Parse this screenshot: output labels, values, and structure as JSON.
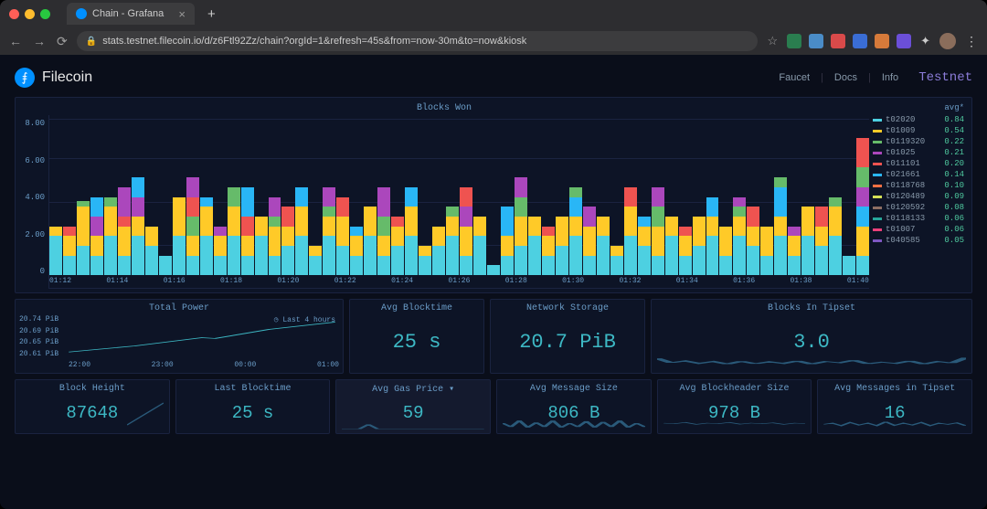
{
  "browser": {
    "tab_title": "Chain - Grafana",
    "url": "stats.testnet.filecoin.io/d/z6Ftl92Zz/chain?orgId=1&refresh=45s&from=now-30m&to=now&kiosk",
    "traffic_lights": [
      "#ff5f57",
      "#ffbd2e",
      "#28c840"
    ],
    "ext_colors": [
      "#2a7d4f",
      "#4a8cc7",
      "#d94a4a",
      "#3a6dd4",
      "#d67a3a",
      "#6b4fd8"
    ]
  },
  "header": {
    "brand": "Filecoin",
    "nav": [
      "Faucet",
      "Docs",
      "Info"
    ],
    "testnet": "Testnet"
  },
  "chart_data": {
    "type": "bar",
    "title": "Blocks Won",
    "ylabel": "",
    "ylim": [
      0,
      8
    ],
    "y_ticks": [
      "8.00",
      "6.00",
      "4.00",
      "2.00",
      "0"
    ],
    "x_ticks": [
      "01:12",
      "01:14",
      "01:16",
      "01:18",
      "01:20",
      "01:22",
      "01:24",
      "01:26",
      "01:28",
      "01:30",
      "01:32",
      "01:34",
      "01:36",
      "01:38",
      "01:40"
    ],
    "series_colors": {
      "t02020": "#4dd0e1",
      "t01009": "#ffca28",
      "t0119320": "#66bb6a",
      "t01025": "#ab47bc",
      "t011101": "#ef5350",
      "t021661": "#29b6f6",
      "t0118768": "#ff7043",
      "t0120489": "#d4e157",
      "t0120592": "#8d6e63",
      "t0118133": "#26a69a",
      "t01007": "#ec407a",
      "t040585": "#7e57c2"
    },
    "stacked_bars": [
      [
        [
          "t02020",
          2
        ],
        [
          "t01009",
          0.5
        ]
      ],
      [
        [
          "t02020",
          1
        ],
        [
          "t01009",
          1
        ],
        [
          "t011101",
          0.5
        ]
      ],
      [
        [
          "t02020",
          1.5
        ],
        [
          "t01009",
          2
        ],
        [
          "t0119320",
          0.3
        ]
      ],
      [
        [
          "t02020",
          1
        ],
        [
          "t01009",
          1
        ],
        [
          "t01025",
          1
        ],
        [
          "t021661",
          1
        ]
      ],
      [
        [
          "t02020",
          2
        ],
        [
          "t01009",
          1.5
        ],
        [
          "t0119320",
          0.5
        ]
      ],
      [
        [
          "t02020",
          1
        ],
        [
          "t01009",
          1.5
        ],
        [
          "t011101",
          0.5
        ],
        [
          "t01025",
          1.5
        ]
      ],
      [
        [
          "t02020",
          2
        ],
        [
          "t01009",
          1
        ],
        [
          "t01025",
          1
        ],
        [
          "t021661",
          1
        ]
      ],
      [
        [
          "t02020",
          1.5
        ],
        [
          "t01009",
          1
        ]
      ],
      [
        [
          "t02020",
          1
        ]
      ],
      [
        [
          "t02020",
          2
        ],
        [
          "t01009",
          2
        ]
      ],
      [
        [
          "t02020",
          1
        ],
        [
          "t01009",
          1
        ],
        [
          "t0119320",
          1
        ],
        [
          "t011101",
          1
        ],
        [
          "t01025",
          1
        ]
      ],
      [
        [
          "t02020",
          2
        ],
        [
          "t01009",
          1.5
        ],
        [
          "t021661",
          0.5
        ]
      ],
      [
        [
          "t02020",
          1
        ],
        [
          "t01009",
          1
        ],
        [
          "t01025",
          0.5
        ]
      ],
      [
        [
          "t02020",
          2
        ],
        [
          "t01009",
          1.5
        ],
        [
          "t0119320",
          1
        ]
      ],
      [
        [
          "t02020",
          1
        ],
        [
          "t01009",
          1
        ],
        [
          "t011101",
          1
        ],
        [
          "t021661",
          1.5
        ]
      ],
      [
        [
          "t02020",
          2
        ],
        [
          "t01009",
          1
        ]
      ],
      [
        [
          "t02020",
          1
        ],
        [
          "t01009",
          1.5
        ],
        [
          "t0119320",
          0.5
        ],
        [
          "t01025",
          1
        ]
      ],
      [
        [
          "t02020",
          1.5
        ],
        [
          "t01009",
          1
        ],
        [
          "t011101",
          1
        ]
      ],
      [
        [
          "t02020",
          2
        ],
        [
          "t01009",
          1.5
        ],
        [
          "t021661",
          1
        ]
      ],
      [
        [
          "t02020",
          1
        ],
        [
          "t01009",
          0.5
        ]
      ],
      [
        [
          "t02020",
          2
        ],
        [
          "t01009",
          1
        ],
        [
          "t0119320",
          0.5
        ],
        [
          "t01025",
          1
        ]
      ],
      [
        [
          "t02020",
          1.5
        ],
        [
          "t01009",
          1.5
        ],
        [
          "t011101",
          1
        ]
      ],
      [
        [
          "t02020",
          1
        ],
        [
          "t01009",
          1
        ],
        [
          "t021661",
          0.5
        ]
      ],
      [
        [
          "t02020",
          2
        ],
        [
          "t01009",
          1.5
        ]
      ],
      [
        [
          "t02020",
          1
        ],
        [
          "t01009",
          1
        ],
        [
          "t0119320",
          1
        ],
        [
          "t01025",
          1.5
        ]
      ],
      [
        [
          "t02020",
          1.5
        ],
        [
          "t01009",
          1
        ],
        [
          "t011101",
          0.5
        ]
      ],
      [
        [
          "t02020",
          2
        ],
        [
          "t01009",
          1.5
        ],
        [
          "t021661",
          1
        ]
      ],
      [
        [
          "t02020",
          1
        ],
        [
          "t01009",
          0.5
        ]
      ],
      [
        [
          "t02020",
          1.5
        ],
        [
          "t01009",
          1
        ]
      ],
      [
        [
          "t02020",
          2
        ],
        [
          "t01009",
          1
        ],
        [
          "t0119320",
          0.5
        ]
      ],
      [
        [
          "t02020",
          1
        ],
        [
          "t01009",
          1.5
        ],
        [
          "t01025",
          1
        ],
        [
          "t011101",
          1
        ]
      ],
      [
        [
          "t02020",
          2
        ],
        [
          "t01009",
          1
        ]
      ],
      [
        [
          "t02020",
          0.5
        ]
      ],
      [
        [
          "t02020",
          1
        ],
        [
          "t01009",
          1
        ],
        [
          "t021661",
          1.5
        ]
      ],
      [
        [
          "t02020",
          1.5
        ],
        [
          "t01009",
          1.5
        ],
        [
          "t0119320",
          1
        ],
        [
          "t01025",
          1
        ]
      ],
      [
        [
          "t02020",
          2
        ],
        [
          "t01009",
          1
        ]
      ],
      [
        [
          "t02020",
          1
        ],
        [
          "t01009",
          1
        ],
        [
          "t011101",
          0.5
        ]
      ],
      [
        [
          "t02020",
          1.5
        ],
        [
          "t01009",
          1.5
        ]
      ],
      [
        [
          "t02020",
          2
        ],
        [
          "t01009",
          1
        ],
        [
          "t021661",
          1
        ],
        [
          "t0119320",
          0.5
        ]
      ],
      [
        [
          "t02020",
          1
        ],
        [
          "t01009",
          1.5
        ],
        [
          "t01025",
          1
        ]
      ],
      [
        [
          "t02020",
          2
        ],
        [
          "t01009",
          1
        ]
      ],
      [
        [
          "t02020",
          1
        ],
        [
          "t01009",
          0.5
        ]
      ],
      [
        [
          "t02020",
          2
        ],
        [
          "t01009",
          1.5
        ],
        [
          "t011101",
          1
        ]
      ],
      [
        [
          "t02020",
          1.5
        ],
        [
          "t01009",
          1
        ],
        [
          "t021661",
          0.5
        ]
      ],
      [
        [
          "t02020",
          1
        ],
        [
          "t01009",
          1.5
        ],
        [
          "t0119320",
          1
        ],
        [
          "t01025",
          1
        ]
      ],
      [
        [
          "t02020",
          2
        ],
        [
          "t01009",
          1
        ]
      ],
      [
        [
          "t02020",
          1
        ],
        [
          "t01009",
          1
        ],
        [
          "t011101",
          0.5
        ]
      ],
      [
        [
          "t02020",
          1.5
        ],
        [
          "t01009",
          1.5
        ]
      ],
      [
        [
          "t02020",
          2
        ],
        [
          "t01009",
          1
        ],
        [
          "t021661",
          1
        ]
      ],
      [
        [
          "t02020",
          1
        ],
        [
          "t01009",
          1.5
        ]
      ],
      [
        [
          "t02020",
          2
        ],
        [
          "t01009",
          1
        ],
        [
          "t0119320",
          0.5
        ],
        [
          "t01025",
          0.5
        ]
      ],
      [
        [
          "t02020",
          1.5
        ],
        [
          "t01009",
          1
        ],
        [
          "t011101",
          1
        ]
      ],
      [
        [
          "t02020",
          1
        ],
        [
          "t01009",
          1.5
        ]
      ],
      [
        [
          "t02020",
          2
        ],
        [
          "t01009",
          1
        ],
        [
          "t021661",
          1.5
        ],
        [
          "t0119320",
          0.5
        ]
      ],
      [
        [
          "t02020",
          1
        ],
        [
          "t01009",
          1
        ],
        [
          "t01025",
          0.5
        ]
      ],
      [
        [
          "t02020",
          2
        ],
        [
          "t01009",
          1.5
        ]
      ],
      [
        [
          "t02020",
          1.5
        ],
        [
          "t01009",
          1
        ],
        [
          "t011101",
          1
        ]
      ],
      [
        [
          "t02020",
          2
        ],
        [
          "t01009",
          1.5
        ],
        [
          "t0119320",
          0.5
        ]
      ],
      [
        [
          "t02020",
          1
        ]
      ],
      [
        [
          "t02020",
          1
        ],
        [
          "t01009",
          1.5
        ],
        [
          "t021661",
          1
        ],
        [
          "t01025",
          1
        ],
        [
          "t0119320",
          1
        ],
        [
          "t011101",
          1.5
        ]
      ]
    ],
    "legend": [
      {
        "name": "t02020",
        "avg": "0.84"
      },
      {
        "name": "t01009",
        "avg": "0.54"
      },
      {
        "name": "t0119320",
        "avg": "0.22"
      },
      {
        "name": "t01025",
        "avg": "0.21"
      },
      {
        "name": "t011101",
        "avg": "0.20"
      },
      {
        "name": "t021661",
        "avg": "0.14"
      },
      {
        "name": "t0118768",
        "avg": "0.10"
      },
      {
        "name": "t0120489",
        "avg": "0.09"
      },
      {
        "name": "t0120592",
        "avg": "0.08"
      },
      {
        "name": "t0118133",
        "avg": "0.06"
      },
      {
        "name": "t01007",
        "avg": "0.06"
      },
      {
        "name": "t040585",
        "avg": "0.05"
      }
    ],
    "legend_header": "avg*"
  },
  "panels": {
    "total_power": {
      "title": "Total Power",
      "badge": "◷ Last 4 hours",
      "y_ticks": [
        "20.74 PiB",
        "20.69 PiB",
        "20.65 PiB",
        "20.61 PiB"
      ],
      "x_ticks": [
        "22:00",
        "23:00",
        "00:00",
        "01:00"
      ],
      "line_points": [
        [
          0,
          85
        ],
        [
          25,
          70
        ],
        [
          50,
          50
        ],
        [
          55,
          52
        ],
        [
          75,
          30
        ],
        [
          100,
          12
        ]
      ]
    },
    "avg_blocktime": {
      "title": "Avg Blocktime",
      "value": "25 s"
    },
    "network_storage": {
      "title": "Network Storage",
      "value": "20.7 PiB"
    },
    "blocks_in_tipset": {
      "title": "Blocks In Tipset",
      "value": "3.0",
      "spark": [
        15,
        50,
        35,
        55,
        40,
        60,
        38,
        58,
        42,
        55,
        35,
        60,
        40,
        50,
        30,
        58,
        45,
        55,
        35,
        60,
        40,
        52,
        10
      ]
    },
    "block_height": {
      "title": "Block Height",
      "value": "87648",
      "spark": [
        90,
        70,
        50,
        30,
        10
      ]
    },
    "last_blocktime": {
      "title": "Last Blocktime",
      "value": "25 s"
    },
    "avg_gas_price": {
      "title": "Avg Gas Price",
      "value": "59",
      "spark": [
        95,
        95,
        95,
        60,
        95,
        95,
        95,
        95,
        95,
        95,
        95,
        95,
        95,
        95,
        95,
        95,
        95
      ]
    },
    "avg_message_size": {
      "title": "Avg Message Size",
      "value": "806 B",
      "spark": [
        50,
        80,
        30,
        85,
        45,
        80,
        30,
        85,
        50,
        80,
        35,
        85,
        40,
        80,
        30,
        85,
        50,
        80
      ]
    },
    "avg_blockheader_size": {
      "title": "Avg Blockheader Size",
      "value": "978 B",
      "spark": [
        50,
        55,
        45,
        60,
        50,
        55,
        45,
        58,
        50,
        55,
        48,
        60,
        50,
        55
      ]
    },
    "avg_messages_in_tipset": {
      "title": "Avg Messages in Tipset",
      "value": "16",
      "spark": [
        60,
        50,
        70,
        45,
        65,
        50,
        70,
        40,
        68,
        50,
        65,
        45,
        70,
        50,
        60,
        48,
        70
      ]
    }
  }
}
